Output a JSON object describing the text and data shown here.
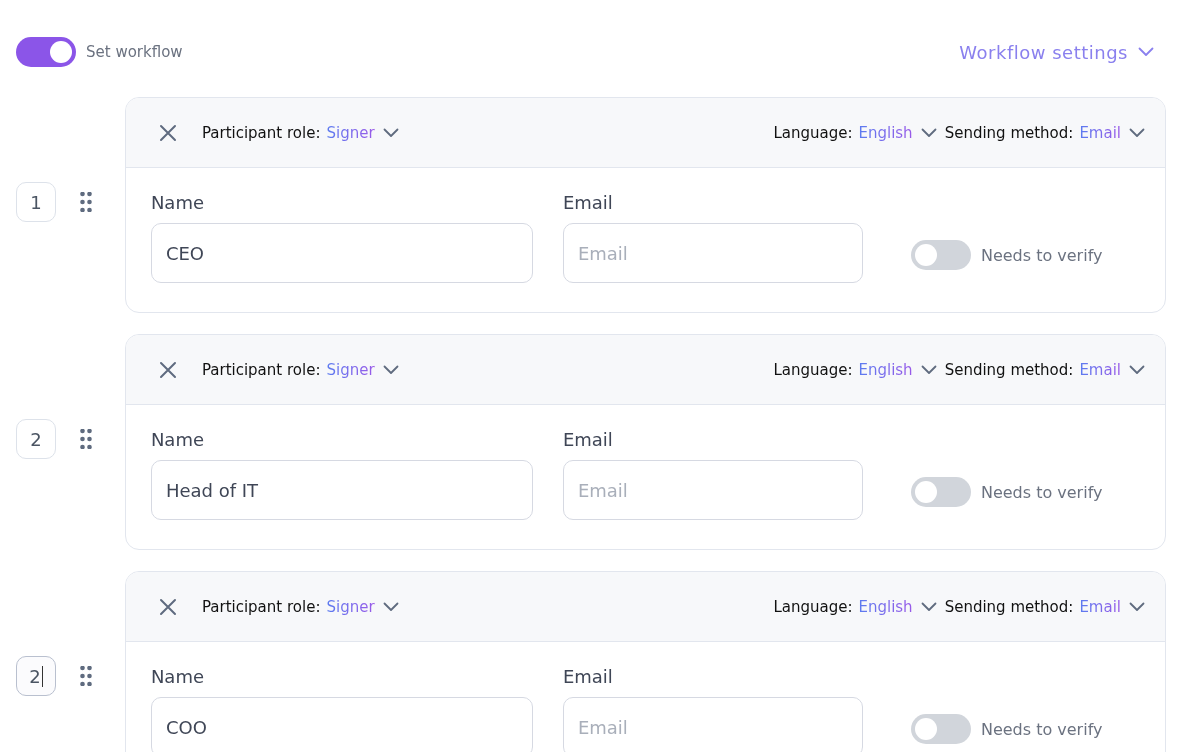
{
  "set_workflow": {
    "label": "Set workflow",
    "on": true
  },
  "workflow_settings": {
    "label": "Workflow settings"
  },
  "participants": [
    {
      "order": "1",
      "focused": false,
      "role_label": "Participant role:",
      "role": "Signer",
      "language_label": "Language:",
      "language": "English",
      "sending_label": "Sending method:",
      "sending_method": "Email",
      "name_field": {
        "label": "Name",
        "value": "CEO"
      },
      "email_field": {
        "label": "Email",
        "placeholder": "Email"
      },
      "verify": {
        "label": "Needs to verify",
        "on": false
      }
    },
    {
      "order": "2",
      "focused": false,
      "role_label": "Participant role:",
      "role": "Signer",
      "language_label": "Language:",
      "language": "English",
      "sending_label": "Sending method:",
      "sending_method": "Email",
      "name_field": {
        "label": "Name",
        "value": "Head of IT"
      },
      "email_field": {
        "label": "Email",
        "placeholder": "Email"
      },
      "verify": {
        "label": "Needs to verify",
        "on": false
      }
    },
    {
      "order": "2",
      "focused": true,
      "role_label": "Participant role:",
      "role": "Signer",
      "language_label": "Language:",
      "language": "English",
      "sending_label": "Sending method:",
      "sending_method": "Email",
      "name_field": {
        "label": "Name",
        "value": "COO"
      },
      "email_field": {
        "label": "Email",
        "placeholder": "Email"
      },
      "verify": {
        "label": "Needs to verify",
        "on": false
      }
    }
  ]
}
